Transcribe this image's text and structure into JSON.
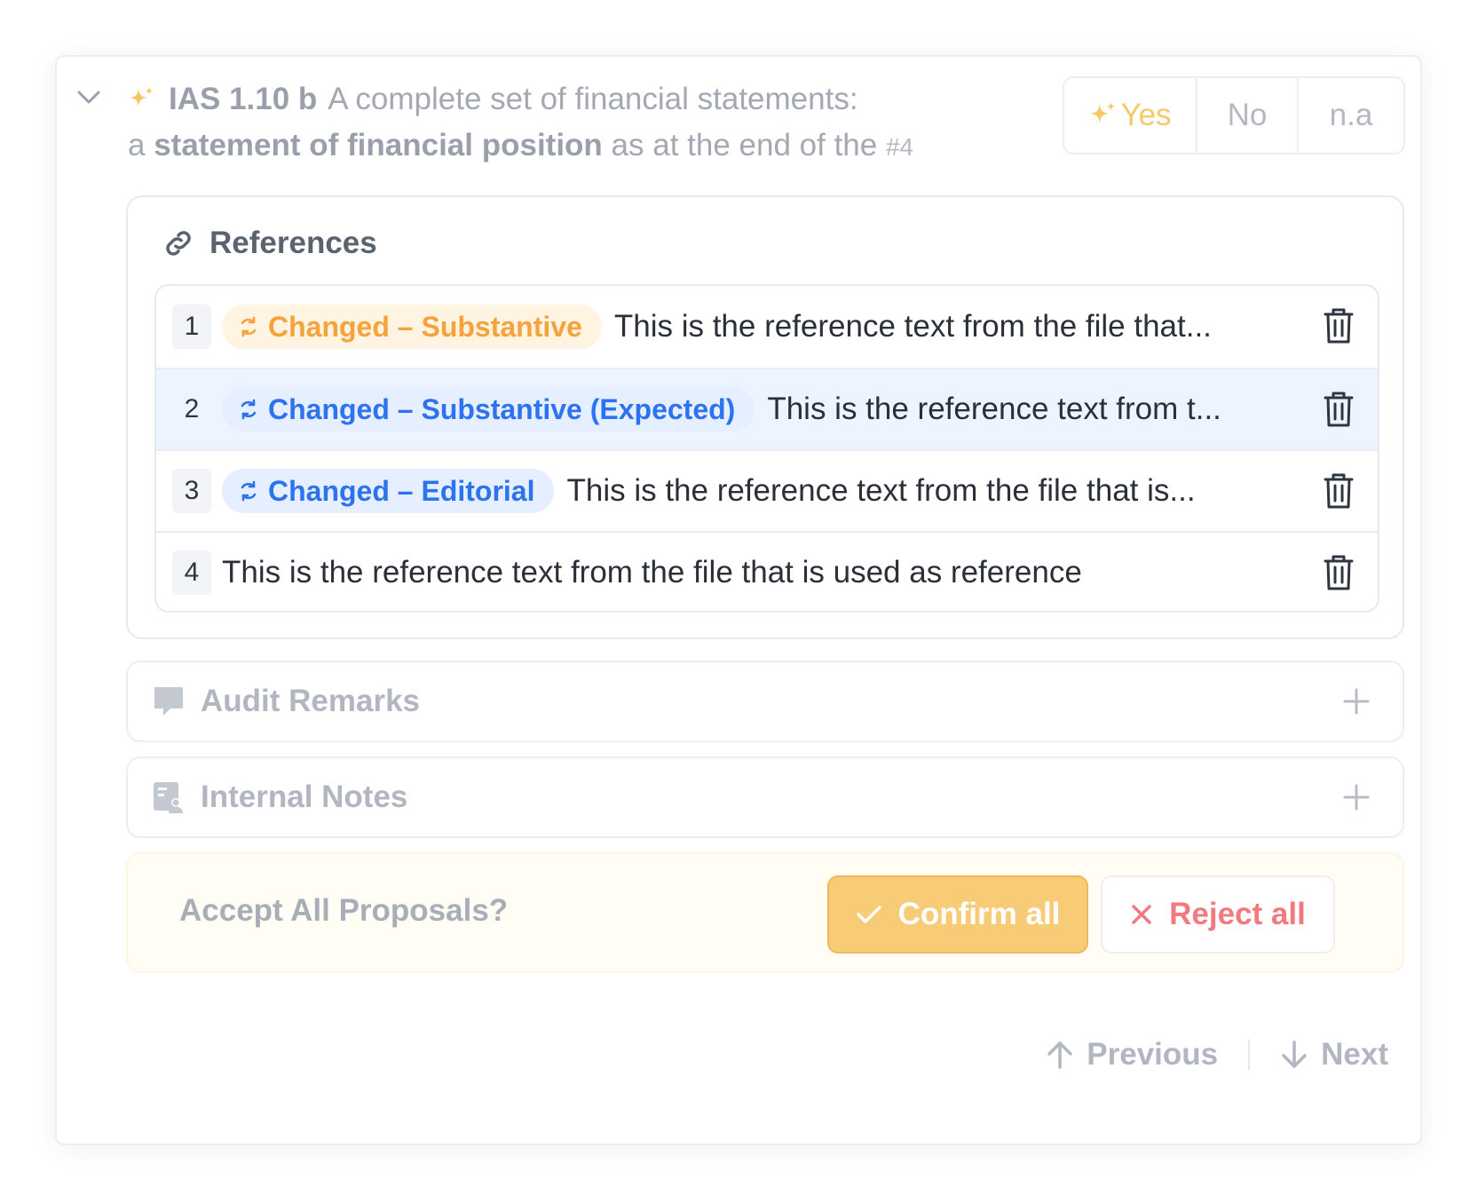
{
  "question": {
    "code": "IAS 1.10 b",
    "text_part1": "A complete set of financial statements:",
    "text_prefix": "a",
    "text_bold": "statement of financial position",
    "text_suffix": "as at the end of the",
    "number": "#4"
  },
  "answers": {
    "yes": "Yes",
    "no": "No",
    "na": "n.a",
    "accent_color": "#f4c96a"
  },
  "references": {
    "title": "References",
    "items": [
      {
        "number": "1",
        "badge": "Changed – Substantive",
        "badge_color": "orange",
        "text": "This is the reference text from the file that..."
      },
      {
        "number": "2",
        "badge": "Changed – Substantive (Expected)",
        "badge_color": "blue",
        "text": "This is the reference text from t..."
      },
      {
        "number": "3",
        "badge": "Changed – Editorial",
        "badge_color": "blue",
        "text": "This is the reference text from the file that is..."
      },
      {
        "number": "4",
        "badge": "",
        "text": "This is the reference text from the file that is used as reference"
      }
    ]
  },
  "sections": {
    "audit_remarks": "Audit Remarks",
    "internal_notes": "Internal Notes"
  },
  "proposals": {
    "question": "Accept All Proposals?",
    "confirm_label": "Confirm all",
    "reject_label": "Reject all"
  },
  "navigation": {
    "previous_label": "Previous",
    "next_label": "Next"
  },
  "colors": {
    "orange_badge_text": "#f5a33a",
    "blue_badge_text": "#2d73f0",
    "confirm_bg": "#f8cc76",
    "reject_text": "#f07a80",
    "selected_row_bg": "#edf4ff"
  }
}
